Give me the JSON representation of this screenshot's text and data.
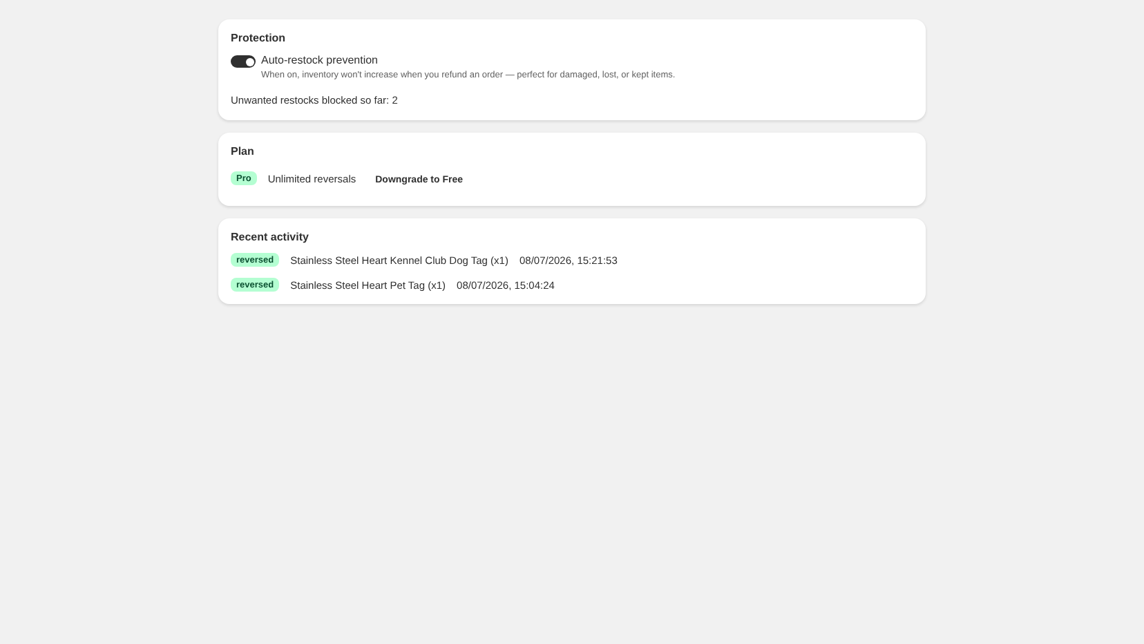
{
  "protection": {
    "title": "Protection",
    "toggle": {
      "label": "Auto-restock prevention",
      "on": true,
      "help": "When on, inventory won't increase when you refund an order — perfect for damaged, lost, or kept items."
    },
    "summary": "Unwanted restocks blocked so far: 2"
  },
  "plan": {
    "title": "Plan",
    "badge": "Pro",
    "description": "Unlimited reversals",
    "action": "Downgrade to Free"
  },
  "activity": {
    "title": "Recent activity",
    "items": [
      {
        "status": "reversed",
        "product": "Stainless Steel Heart Kennel Club Dog Tag (x1)",
        "time": "08/07/2026, 15:21:53"
      },
      {
        "status": "reversed",
        "product": "Stainless Steel Heart Pet Tag (x1)",
        "time": "08/07/2026, 15:04:24"
      }
    ]
  }
}
